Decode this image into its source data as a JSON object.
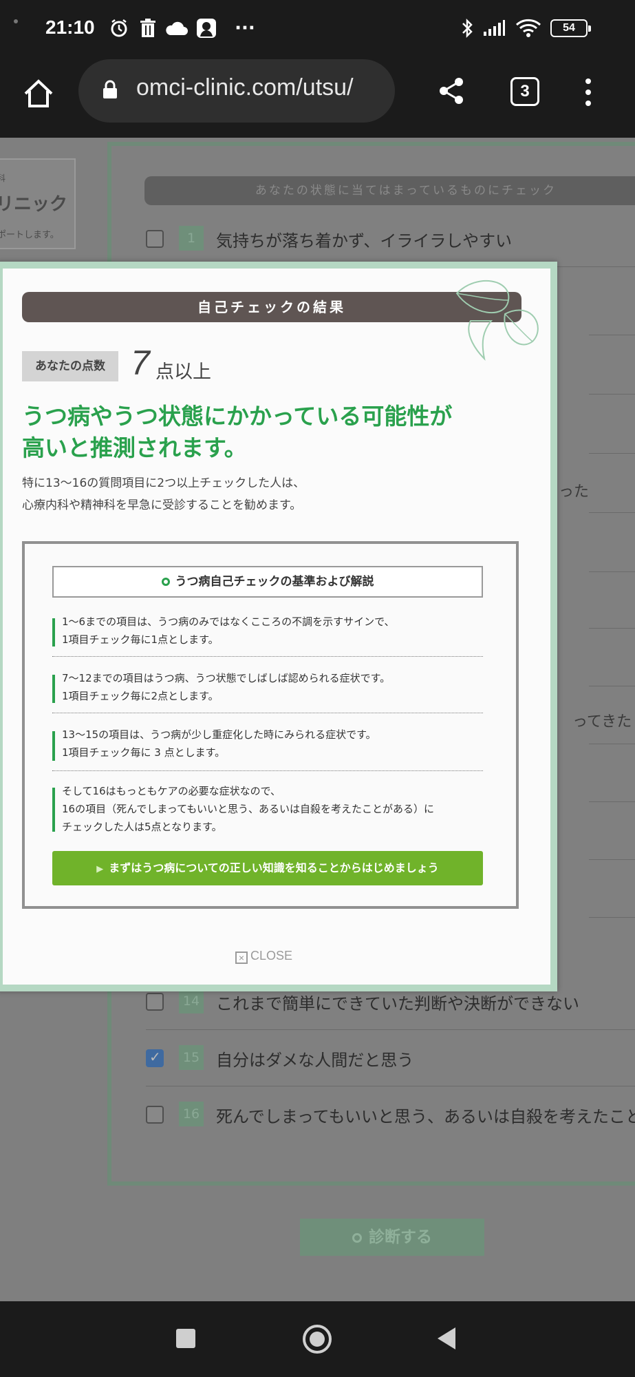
{
  "status_bar": {
    "time": "21:10",
    "icons": [
      "alarm-icon",
      "trash-icon",
      "cloud-icon",
      "account-icon",
      "more-dots-icon",
      "bluetooth-icon",
      "signal-icon",
      "wifi-icon"
    ],
    "overflow": "···",
    "battery": "54"
  },
  "browser": {
    "url": "omci-clinic.com/utsu/",
    "tab_count": "3"
  },
  "background_page": {
    "logo_small": "科",
    "logo_name": "リニック",
    "logo_tagline": "ポートします。",
    "check_header": "あなたの状態に当てはまっているものにチェック",
    "items": [
      {
        "num": "1",
        "text": "気持ちが落ち着かず、イライラしやすい",
        "checked": false
      },
      {
        "num": "14",
        "text": "これまで簡単にできていた判断や決断ができない",
        "checked": false
      },
      {
        "num": "15",
        "text": "自分はダメな人間だと思う",
        "checked": true
      },
      {
        "num": "16",
        "text": "死んでしまってもいいと思う、あるいは自殺を考えたことがある",
        "checked": false
      }
    ],
    "fragments": [
      "った",
      "ってきた"
    ],
    "diagnose_button": "診断する"
  },
  "modal": {
    "title": "自己チェックの結果",
    "score_label": "あなたの点数",
    "score_value": "7",
    "score_suffix": "点以上",
    "headline_line1": "うつ病やうつ状態にかかっている可能性が",
    "headline_line2": "高いと推測されます。",
    "note_line1": "特に13〜16の質問項目に2つ以上チェックした人は、",
    "note_line2": "心療内科や精神科を早急に受診することを勧めます。",
    "criteria_title": "うつ病自己チェックの基準および解説",
    "criteria": [
      {
        "line1": "1〜6までの項目は、うつ病のみではなくこころの不調を示すサインで、",
        "line2": "1項目チェック毎に1点とします。"
      },
      {
        "line1": "7〜12までの項目はうつ病、うつ状態でしばしば認められる症状です。",
        "line2": "1項目チェック毎に2点とします。"
      },
      {
        "line1": "13〜15の項目は、うつ病が少し重症化した時にみられる症状です。",
        "line2": "1項目チェック毎に 3 点とします。"
      },
      {
        "line1": "そして16はもっともケアの必要な症状なので、",
        "line2": "16の項目（死んでしまってもいいと思う、あるいは自殺を考えたことがある）に",
        "line3": "チェックした人は5点となります。"
      }
    ],
    "cta": "まずはうつ病についての正しい知識を知ることからはじめましょう",
    "close": "CLOSE"
  },
  "colors": {
    "accent_green": "#2aa14d",
    "cta_green": "#70b32a",
    "title_bar": "#5f5553",
    "modal_border": "#b5d8c3"
  }
}
